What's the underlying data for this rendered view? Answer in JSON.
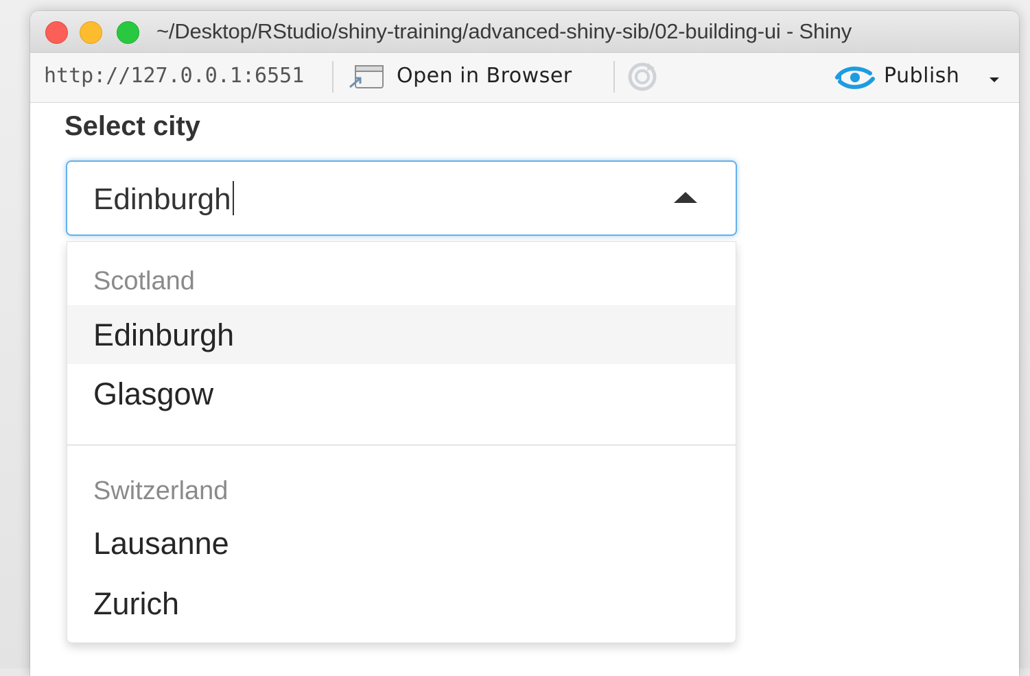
{
  "window": {
    "title": "~/Desktop/RStudio/shiny-training/advanced-shiny-sib/02-building-ui - Shiny"
  },
  "toolbar": {
    "url": "http://127.0.0.1:6551",
    "open_in_browser_label": "Open in Browser",
    "publish_label": "Publish"
  },
  "form": {
    "label": "Select city",
    "input_value": "Edinburgh",
    "groups": [
      {
        "name": "Scotland",
        "options": [
          "Edinburgh",
          "Glasgow"
        ]
      },
      {
        "name": "Switzerland",
        "options": [
          "Lausanne",
          "Zurich"
        ]
      }
    ],
    "highlighted_option": "Edinburgh"
  },
  "colors": {
    "focus_border": "#66afe9",
    "publish_accent": "#1d9ce0",
    "traffic_red": "#fc5f57",
    "traffic_yellow": "#fdbc2e",
    "traffic_green": "#28c840"
  },
  "icons": {
    "open_in_browser": "open-in-browser-icon",
    "refresh": "refresh-icon",
    "publish": "publish-icon",
    "dropdown": "caret-up-icon"
  }
}
